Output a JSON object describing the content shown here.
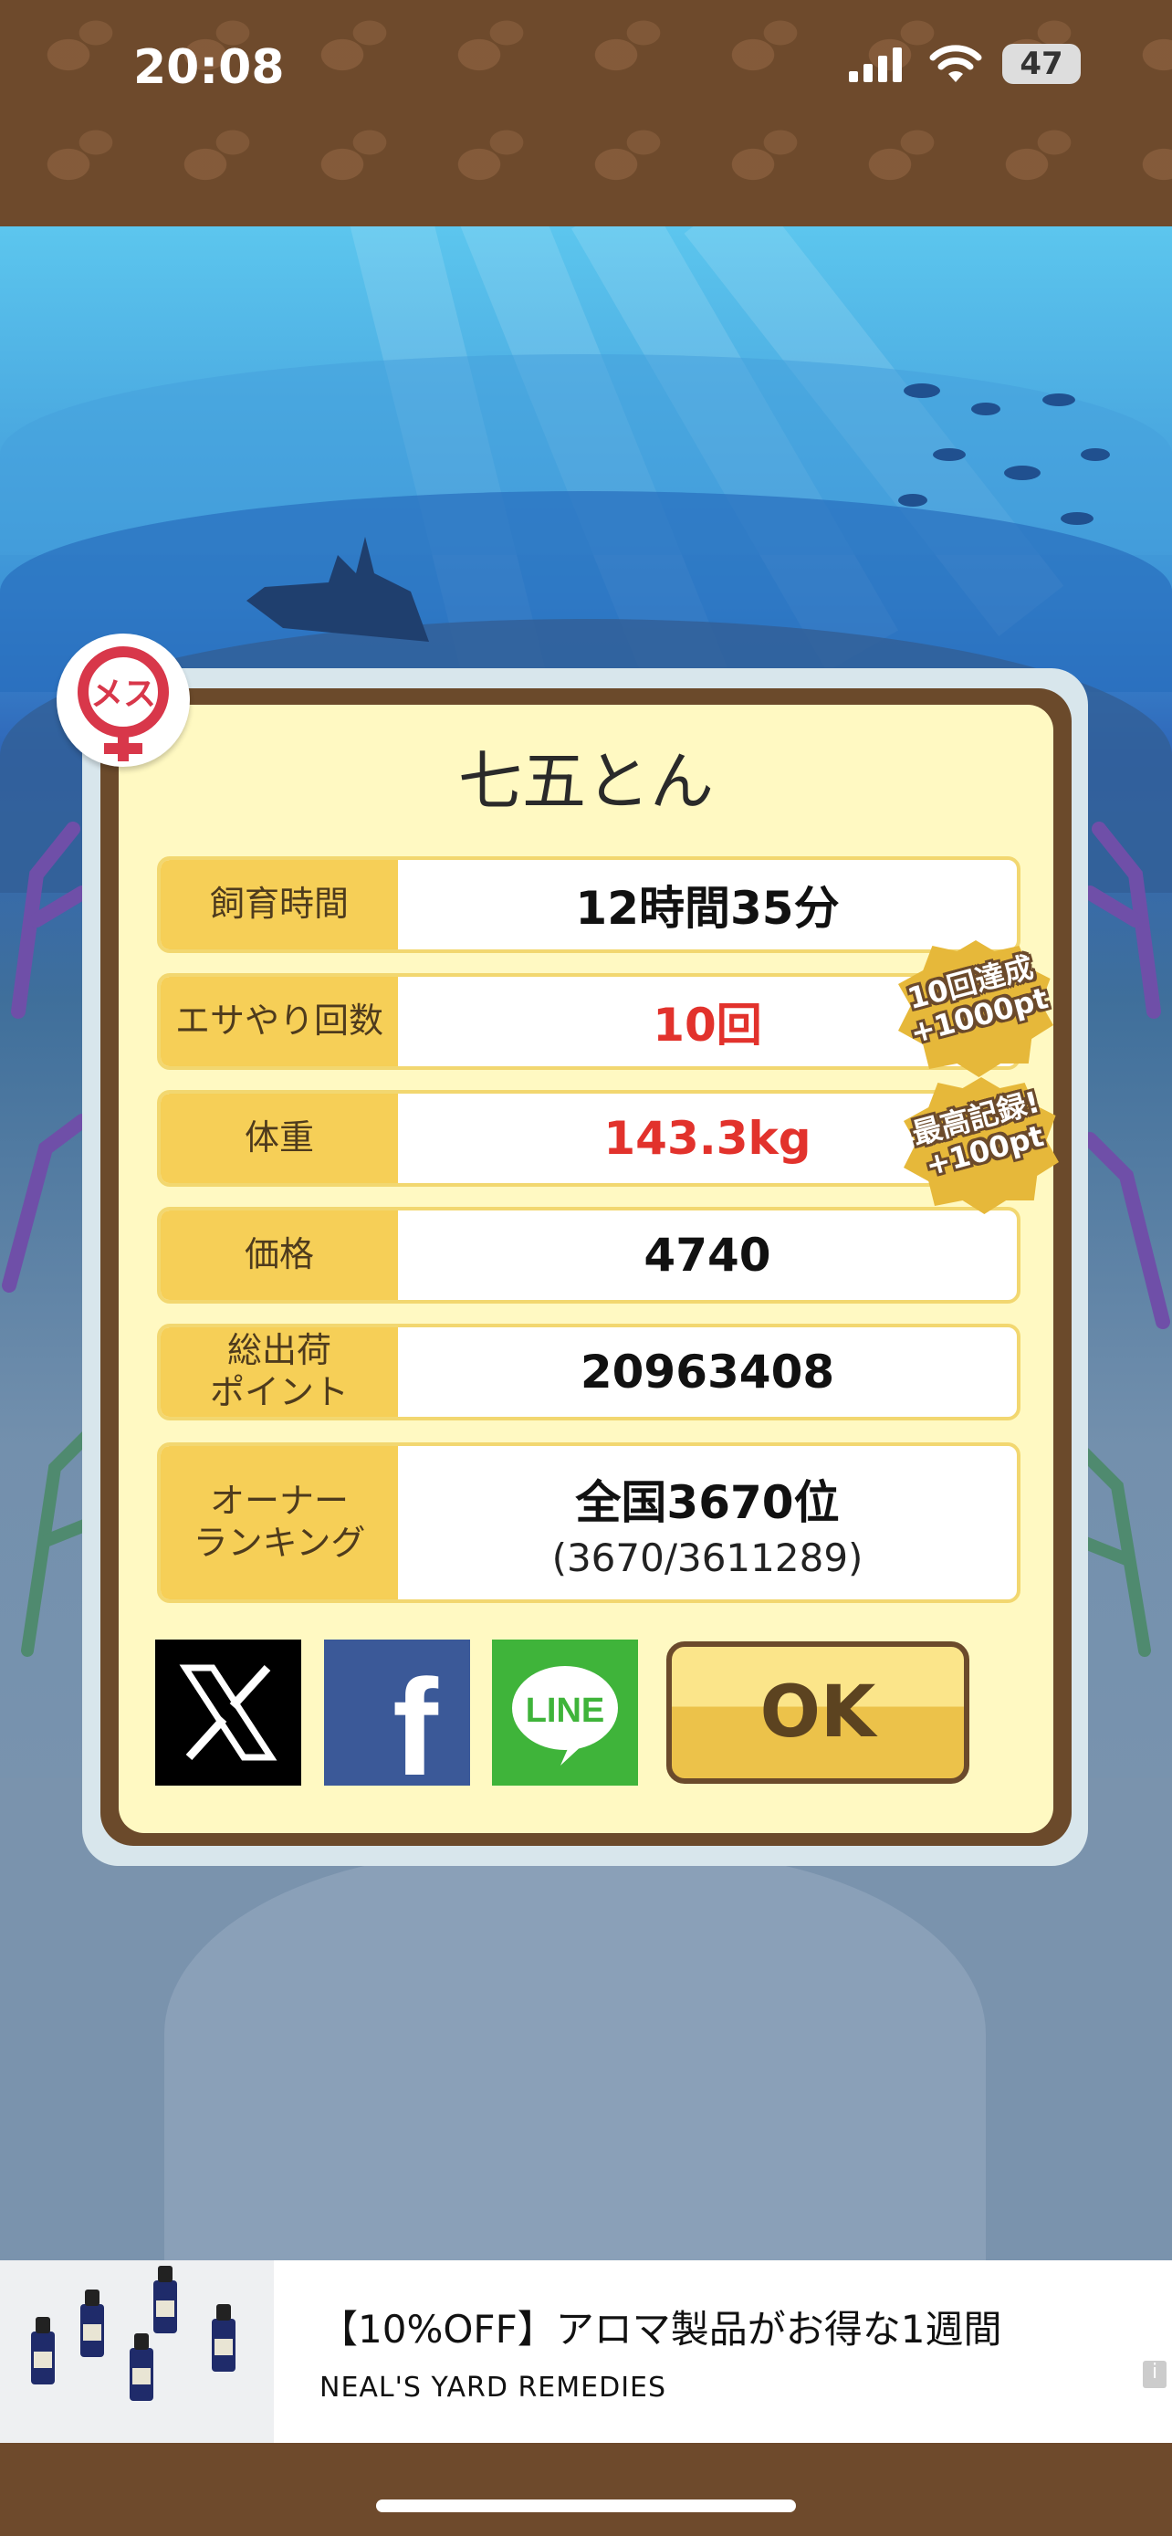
{
  "status_bar": {
    "time": "20:08",
    "battery": "47"
  },
  "card": {
    "gender_label": "メス",
    "name": "七五とん",
    "rows": [
      {
        "label": "飼育時間",
        "value": "12時間35分"
      },
      {
        "label": "エサやり回数",
        "value": "10回"
      },
      {
        "label": "体重",
        "value": "143.3kg"
      },
      {
        "label": "価格",
        "value": "4740"
      },
      {
        "label": "総出荷\nポイント",
        "value": "20963408"
      },
      {
        "label": "オーナー\nランキング",
        "value": "全国3670位",
        "sub_value": "(3670/3611289)"
      }
    ],
    "awards": [
      {
        "text": "10回達成\n+1000pt"
      },
      {
        "text": "最高記録!\n+100pt"
      }
    ],
    "share": {
      "x_label": "X",
      "facebook_label": "f",
      "line_label": "LINE"
    },
    "ok_label": "OK"
  },
  "ad": {
    "title": "【10%OFF】アロマ製品がお得な1週間",
    "advertiser": "NEAL'S YARD REMEDIES",
    "info_icon": "i"
  },
  "colors": {
    "accent_yellow": "#f6cf57",
    "value_red": "#e2322c",
    "frame_brown": "#6b4a2b",
    "card_bg": "#fff9c2"
  },
  "icons": [
    "cellular-signal-icon",
    "wifi-icon",
    "battery-icon",
    "female-gender-icon",
    "x-logo-icon",
    "facebook-logo-icon",
    "line-logo-icon",
    "info-icon"
  ]
}
